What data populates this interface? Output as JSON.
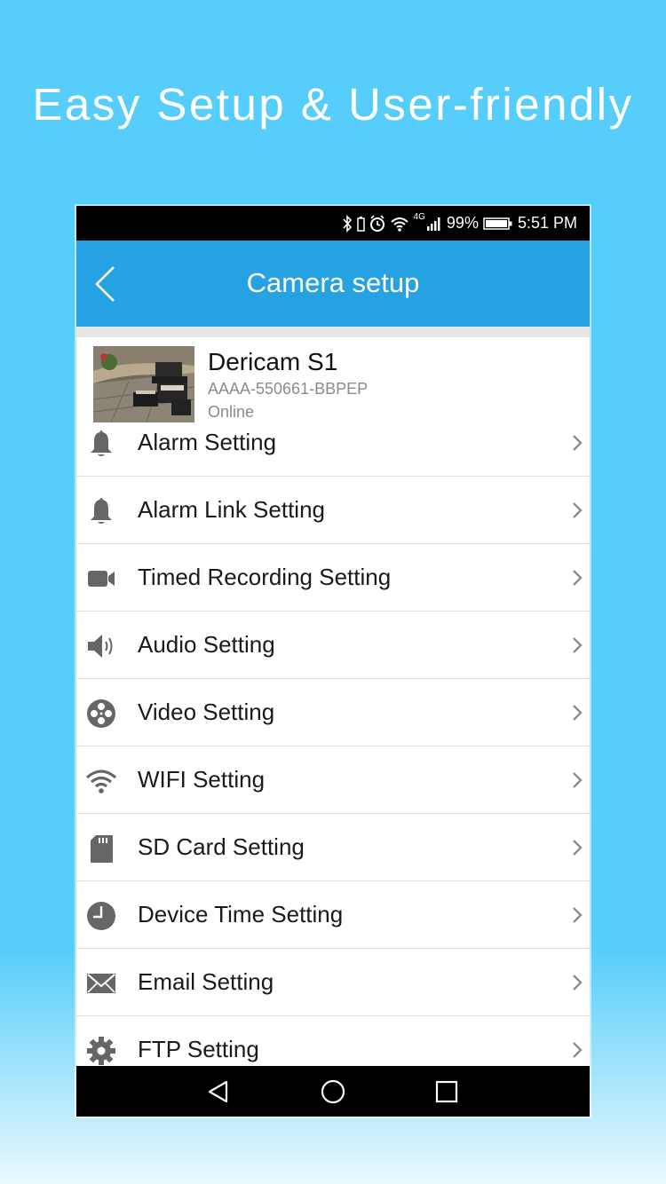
{
  "headline": "Easy Setup & User-friendly",
  "status_bar": {
    "network": "4G",
    "battery": "99%",
    "time": "5:51 PM"
  },
  "appbar": {
    "title": "Camera setup",
    "back_icon": "chevron-left-icon"
  },
  "device": {
    "name": "Dericam S1",
    "id": "AAAA-550661-BBPEP",
    "status": "Online"
  },
  "menu": [
    {
      "label": "Alarm Setting",
      "icon": "bell-icon"
    },
    {
      "label": "Alarm Link Setting",
      "icon": "bell-icon"
    },
    {
      "label": "Timed Recording Setting",
      "icon": "video-camera-icon"
    },
    {
      "label": "Audio Setting",
      "icon": "speaker-icon"
    },
    {
      "label": "Video Setting",
      "icon": "film-reel-icon"
    },
    {
      "label": "WIFI Setting",
      "icon": "wifi-icon"
    },
    {
      "label": "SD Card Setting",
      "icon": "sd-card-icon"
    },
    {
      "label": "Device Time Setting",
      "icon": "clock-icon"
    },
    {
      "label": "Email Setting",
      "icon": "envelope-icon"
    },
    {
      "label": "FTP Setting",
      "icon": "gear-icon"
    }
  ],
  "nav": [
    "back-triangle-icon",
    "home-circle-icon",
    "recents-square-icon"
  ],
  "colors": {
    "background": "#56cdfb",
    "appbar": "#26a2e2",
    "icon_gray": "#666666",
    "chevron_gray": "#8c8c8c"
  }
}
